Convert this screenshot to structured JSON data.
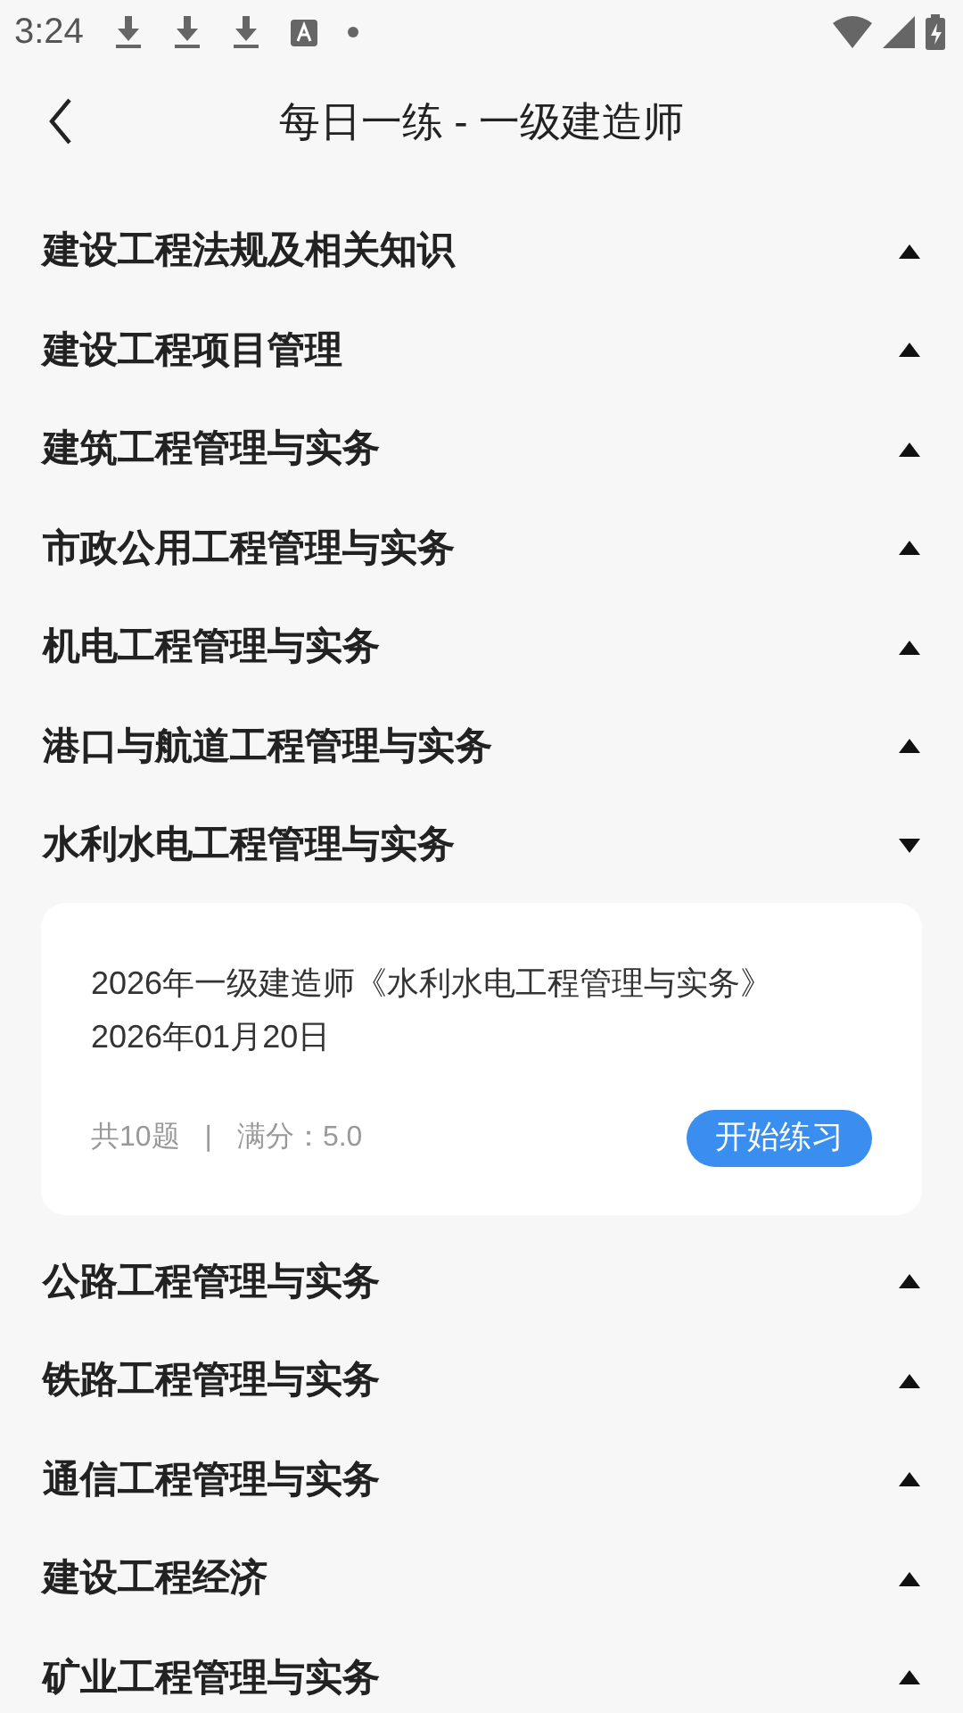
{
  "status_bar": {
    "time": "3:24"
  },
  "header": {
    "title": "每日一练 - 一级建造师"
  },
  "sections": [
    {
      "title": "建设工程法规及相关知识",
      "expanded": false
    },
    {
      "title": "建设工程项目管理",
      "expanded": false
    },
    {
      "title": "建筑工程管理与实务",
      "expanded": false
    },
    {
      "title": "市政公用工程管理与实务",
      "expanded": false
    },
    {
      "title": "机电工程管理与实务",
      "expanded": false
    },
    {
      "title": "港口与航道工程管理与实务",
      "expanded": false
    },
    {
      "title": "水利水电工程管理与实务",
      "expanded": true,
      "exercises": [
        {
          "title": "2026年一级建造师《水利水电工程管理与实务》",
          "date": "2026年01月20日",
          "count": "共10题",
          "separator": "|",
          "score": "满分：5.0",
          "button": "开始练习"
        }
      ]
    },
    {
      "title": "公路工程管理与实务",
      "expanded": false
    },
    {
      "title": "铁路工程管理与实务",
      "expanded": false
    },
    {
      "title": "通信工程管理与实务",
      "expanded": false
    },
    {
      "title": "建设工程经济",
      "expanded": false
    },
    {
      "title": "矿业工程管理与实务",
      "expanded": false
    }
  ]
}
